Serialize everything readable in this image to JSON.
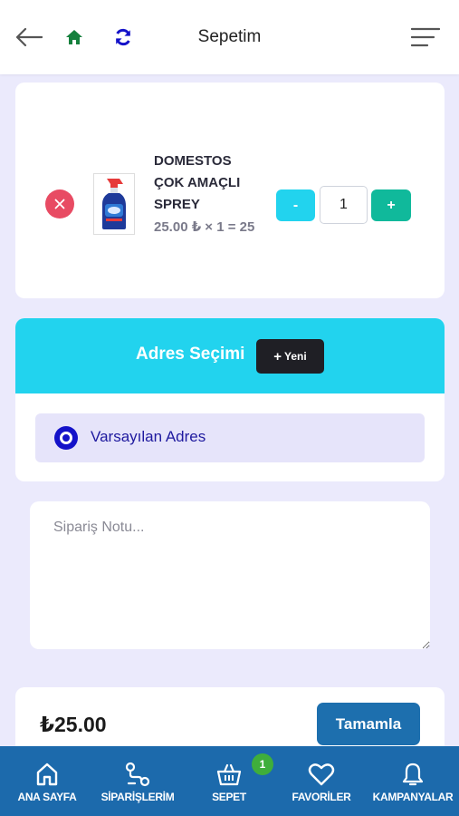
{
  "header": {
    "title": "Sepetim",
    "icons": {
      "back": "arrow-left-icon",
      "home": "home-icon",
      "refresh": "refresh-icon",
      "menu": "menu-icon"
    }
  },
  "cart": {
    "items": [
      {
        "name": "DOMESTOS ÇOK AMAÇLI SPREY",
        "price_line": "25.00 ₺ × 1 = 25",
        "quantity": "1",
        "minus_label": "-",
        "plus_label": "+",
        "image_icon": "spray-bottle-icon"
      }
    ]
  },
  "address": {
    "title": "Adres Seçimi",
    "new_button": "Yeni",
    "options": [
      {
        "label": "Varsayılan Adres",
        "selected": true
      }
    ]
  },
  "note": {
    "placeholder": "Sipariş Notu..."
  },
  "summary": {
    "total": "₺25.00",
    "complete_button": "Tamamla"
  },
  "bottom_nav": {
    "items": [
      {
        "label": "ANA SAYFA",
        "icon": "home-outline-icon"
      },
      {
        "label": "SİPARİŞLERİM",
        "icon": "route-icon"
      },
      {
        "label": "SEPET",
        "icon": "basket-icon",
        "badge": "1"
      },
      {
        "label": "FAVORİLER",
        "icon": "heart-icon"
      },
      {
        "label": "KAMPANYALAR",
        "icon": "bell-icon"
      }
    ]
  },
  "colors": {
    "background": "#ebeafc",
    "accent_cyan": "#22d3ee",
    "danger": "#e84b63",
    "success": "#10b99b",
    "primary_blue": "#1d6fae",
    "nav_blue": "#1c6aac",
    "radio_blue": "#1412c9",
    "badge_green": "#3fae3b"
  }
}
